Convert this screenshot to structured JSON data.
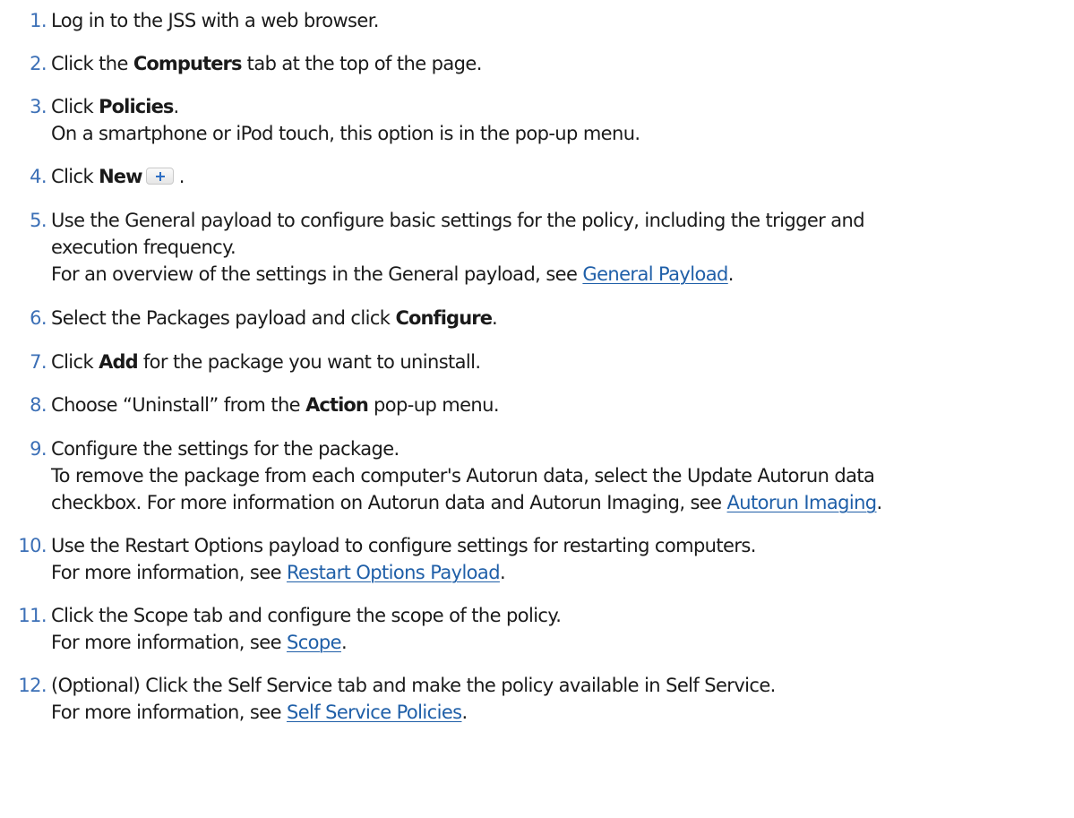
{
  "steps": [
    {
      "number": "1.",
      "line1": {
        "text": "Log in to the JSS with a web browser."
      }
    },
    {
      "number": "2.",
      "line1": {
        "pre": "Click the ",
        "bold": "Computers",
        "post": " tab at the top of the page."
      }
    },
    {
      "number": "3.",
      "line1": {
        "pre": "Click ",
        "bold": "Policies",
        "post": "."
      },
      "line2": {
        "text": "On a smartphone or iPod touch, this option is in the pop-up menu."
      }
    },
    {
      "number": "4.",
      "line1": {
        "pre": "Click ",
        "bold": "New",
        "post": " ."
      },
      "icon": "plus-icon"
    },
    {
      "number": "5.",
      "line1": {
        "text": "Use the General payload to configure basic settings for the policy, including the trigger and"
      },
      "line2": {
        "text": "execution frequency."
      },
      "line3": {
        "pre": "For an overview of the settings in the General payload, see ",
        "link": "General Payload",
        "post": "."
      }
    },
    {
      "number": "6.",
      "line1": {
        "pre": "Select the Packages payload and click ",
        "bold": "Configure",
        "post": "."
      }
    },
    {
      "number": "7.",
      "line1": {
        "pre": "Click ",
        "bold": "Add",
        "post": " for the package you want to uninstall."
      }
    },
    {
      "number": "8.",
      "line1": {
        "pre": "Choose “Uninstall” from the ",
        "bold": "Action",
        "post": " pop-up menu."
      }
    },
    {
      "number": "9.",
      "line1": {
        "text": "Configure the settings for the package."
      },
      "line2": {
        "text": "To remove the package from each computer's Autorun data, select the Update Autorun data"
      },
      "line3": {
        "pre": "checkbox. For more information on Autorun data and Autorun Imaging, see ",
        "link": "Autorun Imaging",
        "post": "."
      }
    },
    {
      "number": "10.",
      "line1": {
        "text": "Use the Restart Options payload to configure settings for restarting computers."
      },
      "line2": {
        "pre": "For more information, see ",
        "link": "Restart Options Payload",
        "post": "."
      }
    },
    {
      "number": "11.",
      "line1": {
        "text": "Click the Scope tab and configure the scope of the policy."
      },
      "line2": {
        "pre": "For more information, see ",
        "link": "Scope",
        "post": "."
      }
    },
    {
      "number": "12.",
      "line1": {
        "text": "(Optional) Click the Self Service tab and make the policy available in Self Service."
      },
      "line2": {
        "pre": "For more information, see ",
        "link": "Self Service Policies",
        "post": "."
      }
    }
  ],
  "colors": {
    "step_number": "#3b6fb6",
    "link": "#1f5fa8",
    "text": "#1a1a1a"
  }
}
